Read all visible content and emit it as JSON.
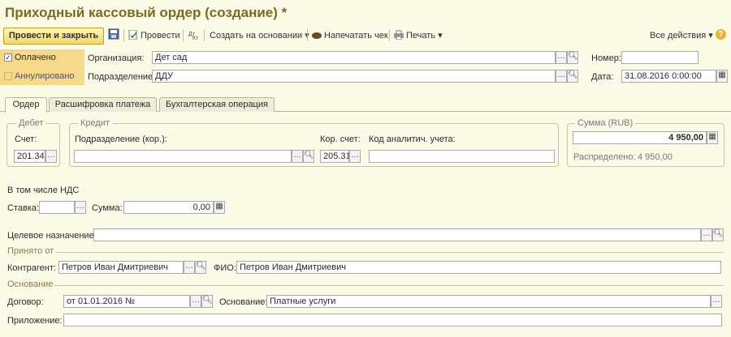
{
  "window": {
    "title": "Приходный кассовый ордер (создание) *"
  },
  "toolbar": {
    "post_close": "Провести и закрыть",
    "post": "Провести",
    "create_based": "Создать на основании",
    "print_receipt": "Напечатать чек",
    "print": "Печать",
    "all_actions": "Все действия",
    "help": "?"
  },
  "status": {
    "paid": "Оплачено",
    "cancelled": "Аннулировано"
  },
  "header": {
    "org_label": "Организация:",
    "org_value": "Дет сад",
    "dept_label": "Подразделение:",
    "dept_value": "ДДУ",
    "number_label": "Номер:",
    "number_value": "",
    "date_label": "Дата:",
    "date_value": "31.08.2016 0:00:00"
  },
  "tabs": [
    "Ордер",
    "Расшифровка платежа",
    "Бухгалтерская операция"
  ],
  "debit": {
    "title": "Дебет",
    "account_label": "Счет:",
    "account_value": "201.34"
  },
  "credit": {
    "title": "Кредит",
    "dept_label": "Подразделение (кор.):",
    "dept_value": "",
    "corr_label": "Кор. счет:",
    "corr_value": "205.31",
    "analytic_label": "Код аналитич. учета:",
    "analytic_value": ""
  },
  "sum": {
    "title": "Сумма (RUB)",
    "value": "4 950,00",
    "distributed_label": "Распределено:",
    "distributed_value": "4 950,00"
  },
  "vat": {
    "title": "В том числе НДС",
    "rate_label": "Ставка:",
    "rate_value": "",
    "amount_label": "Сумма:",
    "amount_value": "0,00"
  },
  "purpose": {
    "label": "Целевое назначение:",
    "value": ""
  },
  "received": {
    "title": "Принято от",
    "contractor_label": "Контрагент:",
    "contractor_value": "Петров Иван Дмитриевич",
    "fio_label": "ФИО:",
    "fio_value": "Петров Иван Дмитриевич"
  },
  "basis": {
    "title": "Основание",
    "contract_label": "Договор:",
    "contract_value": "от 01.01.2016 №",
    "basis_label": "Основание:",
    "basis_value": "Платные услуги",
    "attachment_label": "Приложение:",
    "attachment_value": ""
  },
  "colors": {
    "accent": "#f2d66b",
    "title": "#7a6a2a",
    "background": "#fbfae6"
  }
}
